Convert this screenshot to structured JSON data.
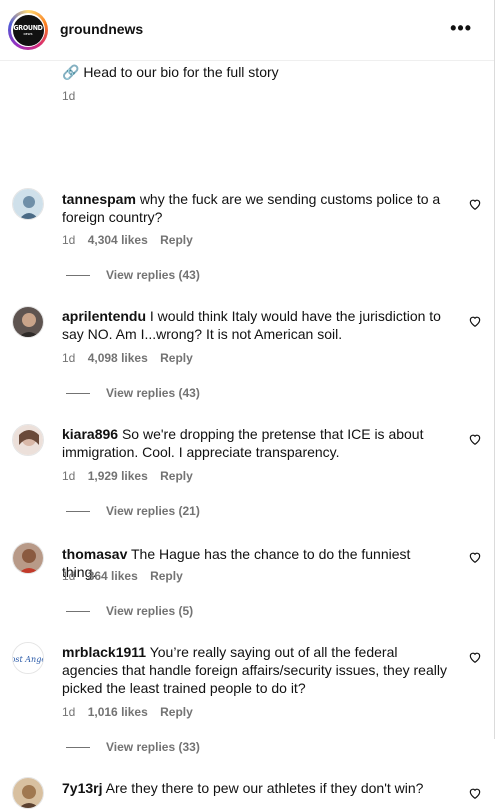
{
  "header": {
    "username": "groundnews",
    "avatar_text": "GROUND",
    "avatar_subtext": "NEWS",
    "more_label": "•••"
  },
  "caption": {
    "text": "🔗 Head to our bio for the full story",
    "time": "1d"
  },
  "comments": [
    {
      "user": "tannespam",
      "text": "why the fuck are we sending customs police to a foreign country?",
      "time": "1d",
      "likes": "4,304 likes",
      "reply": "Reply",
      "view_replies": "View replies (43)",
      "avatar_color": "#a9c7d9"
    },
    {
      "user": "aprilentendu",
      "text": "I would think Italy would have the jurisdiction to say NO. Am I...wrong? It is not American soil.",
      "time": "1d",
      "likes": "4,098 likes",
      "reply": "Reply",
      "view_replies": "View replies (43)",
      "avatar_color": "#8a7a70"
    },
    {
      "user": "kiara896",
      "text": "So we're dropping the pretense that ICE is about immigration. Cool. I appreciate transparency.",
      "time": "1d",
      "likes": "1,929 likes",
      "reply": "Reply",
      "view_replies": "View replies (21)",
      "avatar_color": "#d9c8c0"
    },
    {
      "user": "thomasav",
      "text": "The Hague has the chance to do the funniest thing.",
      "time": "1d",
      "likes": "364 likes",
      "reply": "Reply",
      "view_replies": "View replies (5)",
      "avatar_color": "#7a5a48"
    },
    {
      "user": "mrblack1911",
      "text": "You’re really saying out of all the federal agencies that handle foreign affairs/security issues, they really picked the least trained people to do it?",
      "time": "1d",
      "likes": "1,016 likes",
      "reply": "Reply",
      "view_replies": "View replies (33)",
      "avatar_text": "Lost Angels",
      "avatar_color": "#ffffff"
    },
    {
      "user": "7y13rj",
      "text": "Are they there to pew our athletes if they don't win?",
      "avatar_color": "#b89060"
    }
  ]
}
